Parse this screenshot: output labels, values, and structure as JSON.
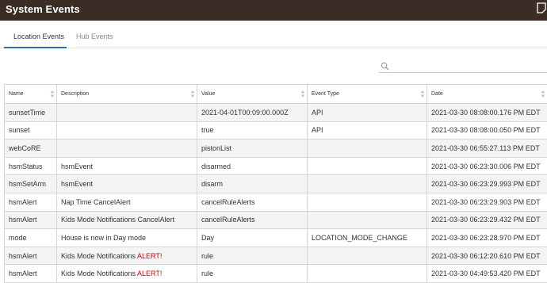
{
  "window": {
    "title": "System Events",
    "corner_icon": "window-corner-icon"
  },
  "tabs": [
    {
      "label": "Location Events",
      "active": true
    },
    {
      "label": "Hub Events",
      "active": false
    }
  ],
  "search": {
    "placeholder": "",
    "value": "",
    "icon": "search-icon"
  },
  "table": {
    "columns": [
      "Name",
      "Description",
      "Value",
      "Event Type",
      "Date"
    ],
    "rows": [
      {
        "name": "sunsetTime",
        "description": "",
        "alert": "",
        "value": "2021-04-01T00:09:00.000Z",
        "type": "API",
        "date": "2021-03-30 08:08:00.176 PM EDT"
      },
      {
        "name": "sunset",
        "description": "",
        "alert": "",
        "value": "true",
        "type": "API",
        "date": "2021-03-30 08:08:00.050 PM EDT"
      },
      {
        "name": "webCoRE",
        "description": "",
        "alert": "",
        "value": "pistonList",
        "type": "",
        "date": "2021-03-30 06:55:27.113 PM EDT"
      },
      {
        "name": "hsmStatus",
        "description": "hsmEvent",
        "alert": "",
        "value": "disarmed",
        "type": "",
        "date": "2021-03-30 06:23:30.006 PM EDT"
      },
      {
        "name": "hsmSetArm",
        "description": "hsmEvent",
        "alert": "",
        "value": "disarm",
        "type": "",
        "date": "2021-03-30 06:23:29.993 PM EDT"
      },
      {
        "name": "hsmAlert",
        "description": "Nap Time CancelAlert",
        "alert": "",
        "value": "cancelRuleAlerts",
        "type": "",
        "date": "2021-03-30 06:23:29.903 PM EDT"
      },
      {
        "name": "hsmAlert",
        "description": "Kids Mode Notifications CancelAlert",
        "alert": "",
        "value": "cancelRuleAlerts",
        "type": "",
        "date": "2021-03-30 06:23:29.432 PM EDT"
      },
      {
        "name": "mode",
        "description": "House is now in Day mode",
        "alert": "",
        "value": "Day",
        "type": "LOCATION_MODE_CHANGE",
        "date": "2021-03-30 06:23:28.970 PM EDT"
      },
      {
        "name": "hsmAlert",
        "description": "Kids Mode Notifications ",
        "alert": "ALERT!",
        "value": "rule",
        "type": "",
        "date": "2021-03-30 06:12:20.610 PM EDT"
      },
      {
        "name": "hsmAlert",
        "description": "Kids Mode Notifications ",
        "alert": "ALERT!",
        "value": "rule",
        "type": "",
        "date": "2021-03-30 04:49:53.420 PM EDT"
      }
    ]
  },
  "colors": {
    "titlebar": "#3b2c25",
    "active_tab": "#2b6fb1",
    "alert": "#d40000",
    "row_stripe": "#f4f4f4"
  }
}
